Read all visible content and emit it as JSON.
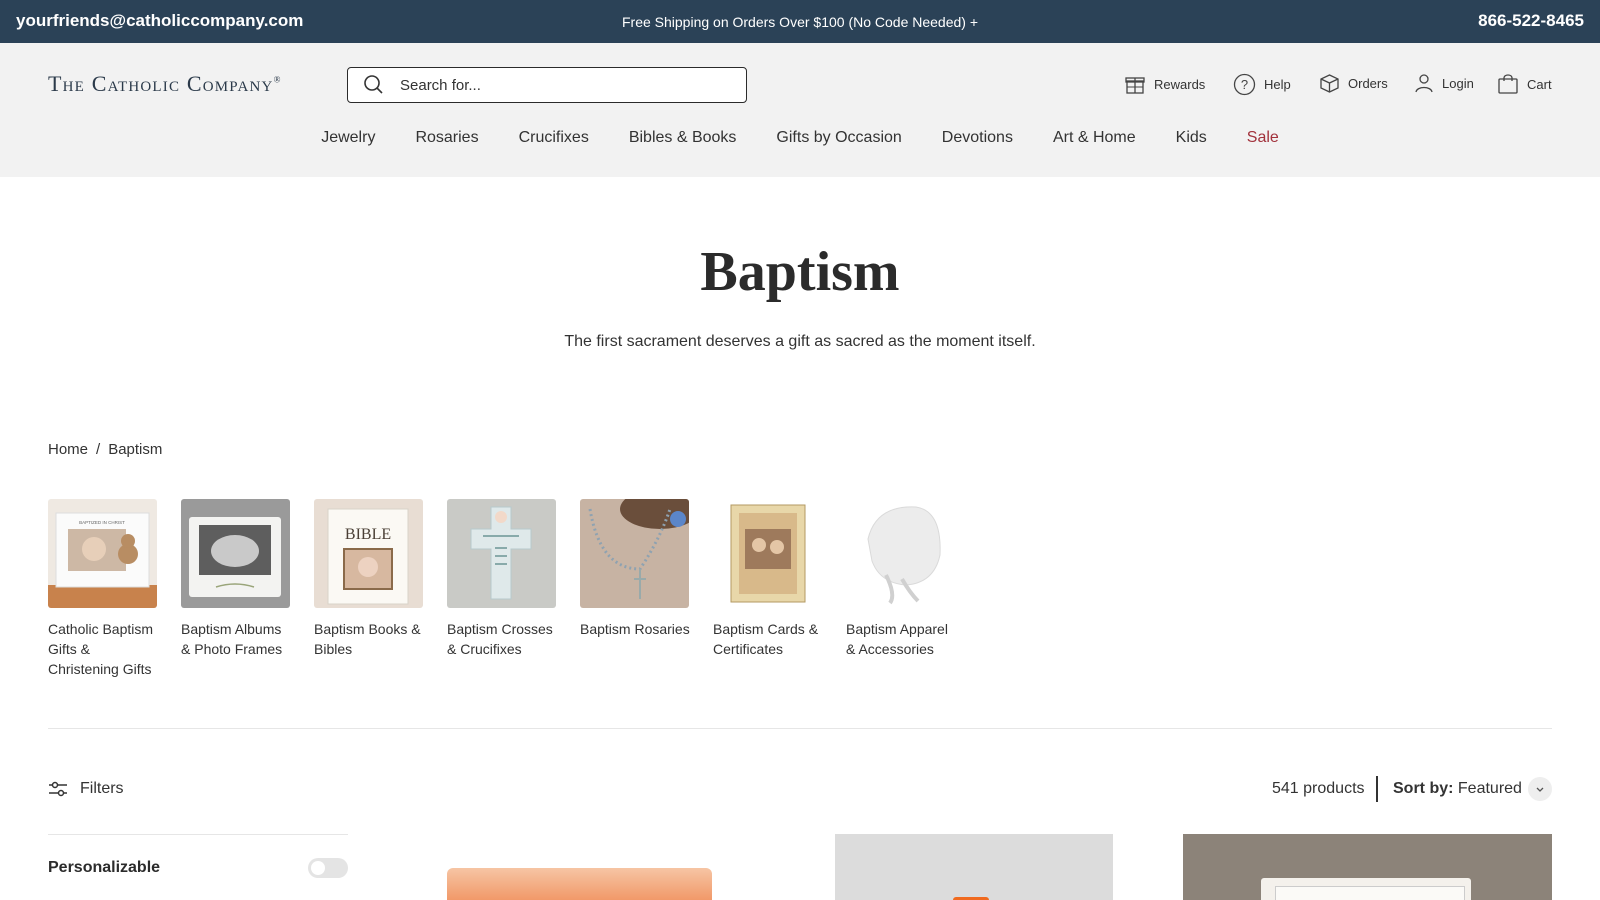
{
  "announcement": {
    "email": "yourfriends@catholiccompany.com",
    "promo": "Free Shipping on Orders Over $100 (No Code Needed) +",
    "phone": "866-522-8465"
  },
  "header": {
    "logo": "The Catholic Company",
    "logo_mark": "®",
    "search_placeholder": "Search for...",
    "utility": {
      "rewards": "Rewards",
      "help": "Help",
      "orders": "Orders",
      "login": "Login",
      "cart": "Cart"
    }
  },
  "nav": {
    "items": [
      "Jewelry",
      "Rosaries",
      "Crucifixes",
      "Bibles & Books",
      "Gifts by Occasion",
      "Devotions",
      "Art & Home",
      "Kids",
      "Sale"
    ]
  },
  "hero": {
    "title": "Baptism",
    "subtitle": "The first sacrament deserves a gift as sacred as the moment itself."
  },
  "breadcrumb": {
    "home": "Home",
    "separator": "/",
    "current": "Baptism"
  },
  "categories": [
    "Catholic Baptism Gifts & Christening Gifts",
    "Baptism Albums & Photo Frames",
    "Baptism Books & Bibles",
    "Baptism Crosses & Crucifixes",
    "Baptism Rosaries",
    "Baptism Cards & Certificates",
    "Baptism Apparel & Accessories"
  ],
  "category_thumb_text": {
    "frame": "BAPTIZED IN CHRIST",
    "bible": "BIBLE"
  },
  "toolbar": {
    "filters": "Filters",
    "count": "541 products",
    "sort_label": "Sort by:",
    "sort_value": "Featured"
  },
  "sidebar": {
    "personalizable": "Personalizable"
  },
  "colors": {
    "announce_bg": "#2b4257",
    "header_bg": "#f2f2f2",
    "sale": "#a2323c"
  }
}
